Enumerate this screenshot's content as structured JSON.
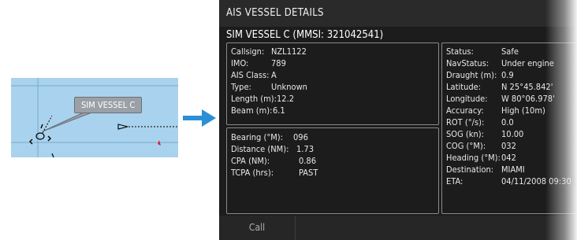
{
  "chart": {
    "vessel_label": "SIM VESSEL C"
  },
  "dialog": {
    "title": "AIS VESSEL DETAILS",
    "vessel_header": "SIM VESSEL C (MMSI: 321042541)",
    "identity": [
      {
        "label": "Callsign:",
        "value": "NZL1122"
      },
      {
        "label": "IMO:",
        "value": "789"
      },
      {
        "label": "AIS Class:",
        "value": "A"
      },
      {
        "label": "Type:",
        "value": "Unknown"
      },
      {
        "label": "Length (m):",
        "value": "12.2"
      },
      {
        "label": "Beam (m):",
        "value": "6.1"
      }
    ],
    "navigation": [
      {
        "label": "Bearing (°M):",
        "value": "096"
      },
      {
        "label": "Distance (NM):",
        "value": "1.73"
      },
      {
        "label": "CPA (NM):",
        "value": "0.86"
      },
      {
        "label": "TCPA (hrs):",
        "value": "PAST"
      }
    ],
    "status": [
      {
        "label": "Status:",
        "value": "Safe"
      },
      {
        "label": "NavStatus:",
        "value": "Under engine"
      },
      {
        "label": "Draught (m):",
        "value": "0.9"
      },
      {
        "label": "Latitude:",
        "value": "N  25°45.842'"
      },
      {
        "label": "Longitude:",
        "value": "W  80°06.978'"
      },
      {
        "label": "Accuracy:",
        "value": "High (10m)"
      },
      {
        "label": "ROT (°/s):",
        "value": "0.0"
      },
      {
        "label": "SOG (kn):",
        "value": "10.00"
      },
      {
        "label": "COG (°M):",
        "value": "032"
      },
      {
        "label": "Heading (°M):",
        "value": "042"
      },
      {
        "label": "Destination:",
        "value": "MIAMI"
      },
      {
        "label": "ETA:",
        "value": "04/11/2008 09:30"
      }
    ],
    "call_button": "Call"
  },
  "colors": {
    "panel_bg": "#1c1c1c",
    "chart_water": "#a9d2ee",
    "arrow": "#2b8fd6"
  }
}
